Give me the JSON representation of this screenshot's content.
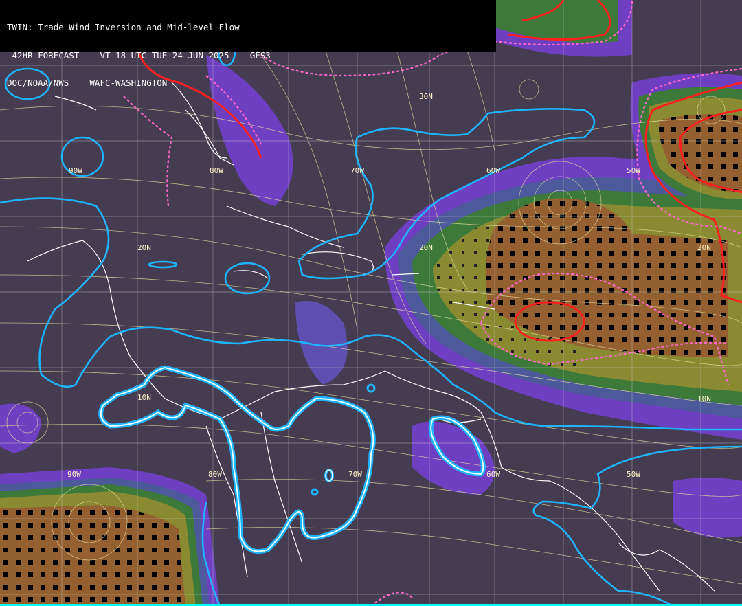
{
  "header": {
    "line1": "TWIN: Trade Wind Inversion and Mid-level Flow",
    "line2": " 42HR FORECAST    VT 18 UTC TUE 24 JUN 2025    GFS3",
    "line3": "DOC/NOAA/NWS    WAFC-WASHINGTON"
  },
  "grid_labels": {
    "lat": [
      "30N",
      "20N",
      "20N",
      "20N",
      "10N",
      "10N"
    ],
    "lon": [
      "90W",
      "80W",
      "70W",
      "60W",
      "50W",
      "90W",
      "80W",
      "70W",
      "60W",
      "50W"
    ],
    "lon_first": "90W",
    "lon_second": "80W"
  },
  "colors": {
    "background": "#463c52",
    "purple_shade": "#7a3fc8",
    "blue_shade": "#4a5a9a",
    "green_shade": "#3e7a3a",
    "olive_shade": "#8a8a30",
    "brown_shade": "#946032",
    "streamlines": "#e8e0a0",
    "inversion_contour": "#1fb4ff",
    "red_contour": "#ff2020",
    "magenta_dashed": "#ff66cc",
    "coastline": "#ffffff"
  }
}
